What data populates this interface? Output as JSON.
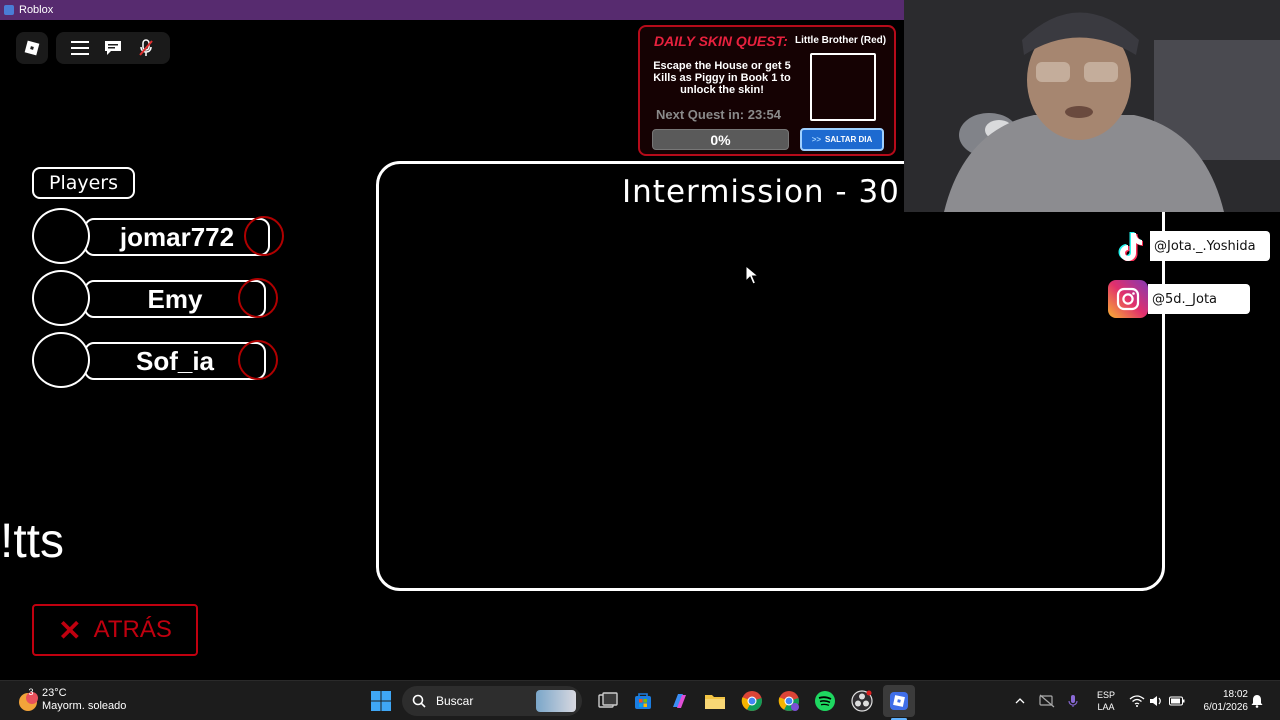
{
  "window": {
    "title": "Roblox"
  },
  "players": {
    "label": "Players",
    "list": [
      {
        "name": "jomar772"
      },
      {
        "name": "Emy"
      },
      {
        "name": "Sof_ia"
      }
    ]
  },
  "chat_text": "!tts",
  "back_button": {
    "label": "ATRÁS"
  },
  "main": {
    "status": "Intermission - 30"
  },
  "quest": {
    "title": "DAILY SKIN QUEST:",
    "skin": "Little Brother (Red)",
    "description": "Escape the House or get 5 Kills as Piggy in Book 1 to unlock the skin!",
    "next_label": "Next Quest in:",
    "timer": "23:54",
    "progress_percent": 0,
    "progress_text": "0%",
    "skip_label": "SALTAR DIA",
    "skip_arrows": ">>"
  },
  "social": {
    "tiktok": "@Jota._.Yoshida",
    "instagram": "@5d._Jota"
  },
  "taskbar": {
    "weather_temp": "23°C",
    "weather_desc": "Mayorm. soleado",
    "weather_badge": "3",
    "search_label": "Buscar",
    "language": "ESP",
    "layout": "LAA",
    "time": "18:02",
    "date": "6/01/2026"
  },
  "colors": {
    "title_bar": "#572b6f",
    "quest_red": "#e8213e",
    "back_red": "#c0000f",
    "skip_blue": "#1d6ad0"
  }
}
